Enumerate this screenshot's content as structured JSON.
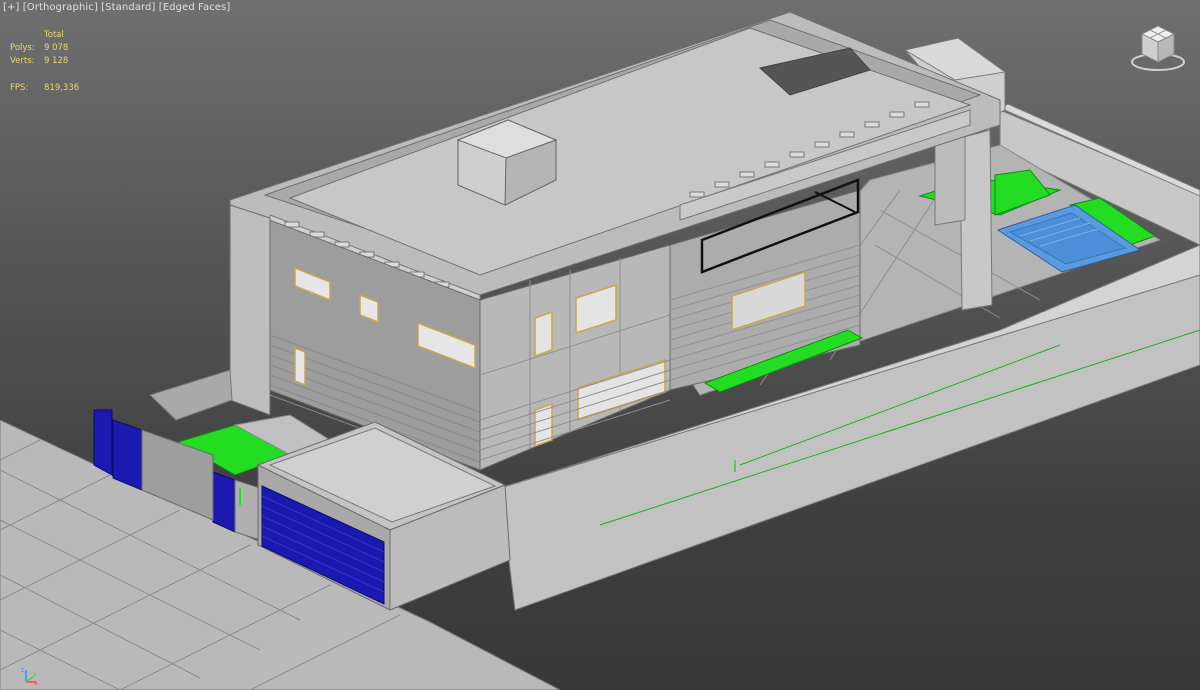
{
  "viewport": {
    "labels": [
      "[+]",
      "[Orthographic]",
      "[Standard]",
      "[Edged Faces]"
    ]
  },
  "stats": {
    "header": "Total",
    "polys_label": "Polys:",
    "polys_value": "9 078",
    "verts_label": "Verts:",
    "verts_value": "9 128",
    "fps_label": "FPS:",
    "fps_value": "819,336"
  },
  "axis": {
    "x": "x",
    "y": "y",
    "z": "z"
  },
  "colors": {
    "stats_text": "#e8d96a",
    "grass": "#22dd22",
    "glass_blue": "#1a1ab0",
    "pool": "#4a8fd8",
    "window_frame": "#c9a64a"
  },
  "icons": {
    "viewcube": "viewcube-icon",
    "axis": "axis-tripod-icon"
  }
}
